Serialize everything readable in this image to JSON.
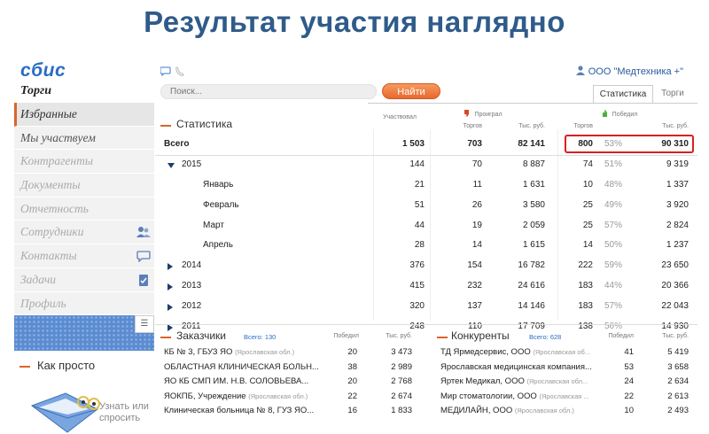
{
  "slide_title": "Результат участия наглядно",
  "brand": "сбис",
  "sidebar": {
    "section": "Торги",
    "items": [
      {
        "label": "Избранные"
      },
      {
        "label": "Мы участвуем"
      },
      {
        "label": "Контрагенты"
      },
      {
        "label": "Документы"
      },
      {
        "label": "Отчетность"
      },
      {
        "label": "Сотрудники",
        "icon": "users-icon"
      },
      {
        "label": "Контакты",
        "icon": "chat-icon"
      },
      {
        "label": "Задачи",
        "icon": "clipboard-check-icon"
      },
      {
        "label": "Профиль"
      }
    ],
    "howto_title": "Как просто",
    "learn_text_1": "Узнать или",
    "learn_text_2": "спросить"
  },
  "header": {
    "org": "ООО \"Медтехника +\"",
    "search_placeholder": "Поиск...",
    "find_button": "Найти",
    "tabs": [
      "Статистика",
      "Торги"
    ]
  },
  "stats": {
    "title": "Статистика",
    "group_participated": "Участвовал",
    "group_lost": "Проиграл",
    "group_won": "Победил",
    "col_torgov": "Торгов",
    "col_tys": "Тыс. руб.",
    "rows": [
      {
        "label": "Всего",
        "kind": "total",
        "part": "1 503",
        "lost_n": "703",
        "lost_sum": "82 141",
        "won_n": "800",
        "won_pct": "53%",
        "won_sum": "90 310"
      },
      {
        "label": "2015",
        "kind": "year-open",
        "part": "144",
        "lost_n": "70",
        "lost_sum": "8 887",
        "won_n": "74",
        "won_pct": "51%",
        "won_sum": "9 319"
      },
      {
        "label": "Январь",
        "kind": "month",
        "part": "21",
        "lost_n": "11",
        "lost_sum": "1 631",
        "won_n": "10",
        "won_pct": "48%",
        "won_sum": "1 337"
      },
      {
        "label": "Февраль",
        "kind": "month",
        "part": "51",
        "lost_n": "26",
        "lost_sum": "3 580",
        "won_n": "25",
        "won_pct": "49%",
        "won_sum": "3 920"
      },
      {
        "label": "Март",
        "kind": "month",
        "part": "44",
        "lost_n": "19",
        "lost_sum": "2 059",
        "won_n": "25",
        "won_pct": "57%",
        "won_sum": "2 824"
      },
      {
        "label": "Апрель",
        "kind": "month",
        "part": "28",
        "lost_n": "14",
        "lost_sum": "1 615",
        "won_n": "14",
        "won_pct": "50%",
        "won_sum": "1 237"
      },
      {
        "label": "2014",
        "kind": "year",
        "part": "376",
        "lost_n": "154",
        "lost_sum": "16 782",
        "won_n": "222",
        "won_pct": "59%",
        "won_sum": "23 650"
      },
      {
        "label": "2013",
        "kind": "year",
        "part": "415",
        "lost_n": "232",
        "lost_sum": "24 616",
        "won_n": "183",
        "won_pct": "44%",
        "won_sum": "20 366"
      },
      {
        "label": "2012",
        "kind": "year",
        "part": "320",
        "lost_n": "137",
        "lost_sum": "14 146",
        "won_n": "183",
        "won_pct": "57%",
        "won_sum": "22 043"
      },
      {
        "label": "2011",
        "kind": "year",
        "part": "248",
        "lost_n": "110",
        "lost_sum": "17 709",
        "won_n": "138",
        "won_pct": "56%",
        "won_sum": "14 930"
      }
    ]
  },
  "customers": {
    "title": "Заказчики",
    "count": "Всего: 130",
    "col_won": "Победил",
    "col_sum": "Тыс. руб.",
    "rows": [
      {
        "name": "КБ № 3, ГБУЗ ЯО",
        "region": "(Ярославская обл.)",
        "won": "20",
        "sum": "3 473"
      },
      {
        "name": "ОБЛАСТНАЯ КЛИНИЧЕСКАЯ БОЛЬН...",
        "region": "",
        "won": "38",
        "sum": "2 989"
      },
      {
        "name": "ЯО КБ СМП ИМ. Н.В. СОЛОВЬЕВА...",
        "region": "",
        "won": "20",
        "sum": "2 768"
      },
      {
        "name": "ЯОКПБ, Учреждение",
        "region": "(Ярославская обл.)",
        "won": "22",
        "sum": "2 674"
      },
      {
        "name": "Клиническая больница № 8, ГУЗ ЯО...",
        "region": "",
        "won": "16",
        "sum": "1 833"
      }
    ]
  },
  "competitors": {
    "title": "Конкуренты",
    "count": "Всего: 628",
    "col_won": "Победил",
    "col_sum": "Тыс. руб.",
    "rows": [
      {
        "name": "ТД Ярмедсервис, ООО",
        "region": "(Ярославская об...",
        "won": "41",
        "sum": "5 419"
      },
      {
        "name": "Ярославская медицинская компания...",
        "region": "",
        "won": "53",
        "sum": "3 658"
      },
      {
        "name": "Яртек Медикал, ООО",
        "region": "(Ярославская обл...",
        "won": "24",
        "sum": "2 634"
      },
      {
        "name": "Мир стоматологии, ООО",
        "region": "(Ярославская ...",
        "won": "22",
        "sum": "2 613"
      },
      {
        "name": "МЕДИЛАЙН, ООО",
        "region": "(Ярославская обл.)",
        "won": "10",
        "sum": "2 493"
      }
    ]
  },
  "colors": {
    "title": "#2f5b8a",
    "accent": "#d9662a",
    "brand": "#2a6cc4",
    "highlight": "#d92020"
  }
}
